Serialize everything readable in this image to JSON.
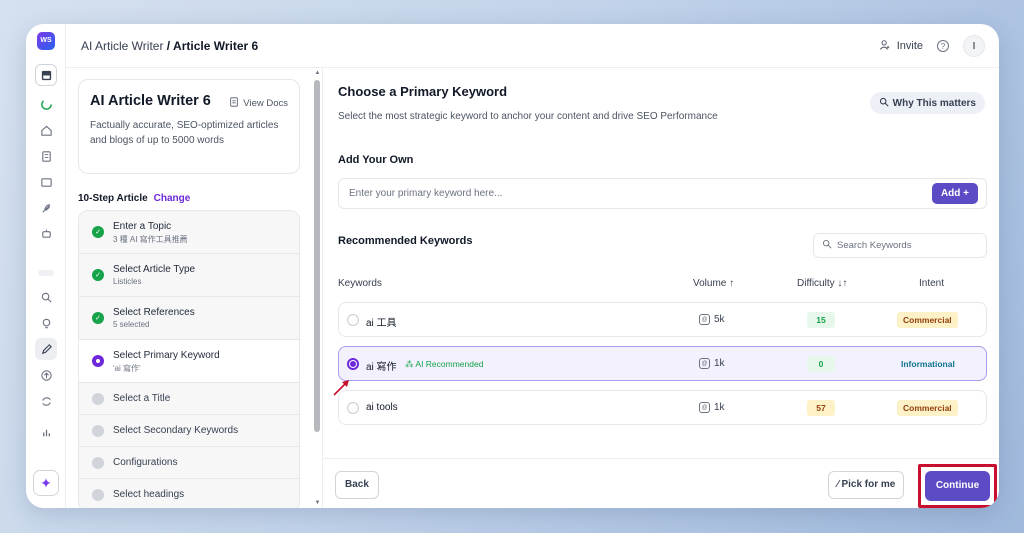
{
  "header": {
    "breadcrumb_parent": "AI Article Writer",
    "breadcrumb_sep": " / ",
    "breadcrumb_current": "Article Writer 6",
    "invite_label": "Invite",
    "help_symbol": "?",
    "avatar_initial": "I"
  },
  "rail": {
    "logo": "WS"
  },
  "info_card": {
    "title": "AI Article Writer 6",
    "view_docs": "View Docs",
    "description": "Factually accurate, SEO-optimized articles and blogs of up to 5000 words"
  },
  "steps_header": {
    "label": "10-Step Article",
    "change": "Change"
  },
  "steps": [
    {
      "title": "Enter a Topic",
      "sub": "3 種 AI 寫作工具推薦",
      "state": "done"
    },
    {
      "title": "Select Article Type",
      "sub": "Listicles",
      "state": "done"
    },
    {
      "title": "Select References",
      "sub": "5 selected",
      "state": "done"
    },
    {
      "title": "Select Primary Keyword",
      "sub": "'ai 寫作'",
      "state": "current"
    },
    {
      "title": "Select a Title",
      "state": "pending"
    },
    {
      "title": "Select Secondary Keywords",
      "state": "pending"
    },
    {
      "title": "Configurations",
      "state": "pending"
    },
    {
      "title": "Select headings",
      "state": "pending"
    }
  ],
  "main": {
    "title": "Choose a Primary Keyword",
    "subtitle": "Select the most strategic keyword to anchor your content and drive SEO Performance",
    "why_button": "Why This matters",
    "add_own_label": "Add Your Own",
    "keyword_input_placeholder": "Enter your primary keyword here...",
    "add_button": "Add +",
    "recommended_label": "Recommended Keywords",
    "search_placeholder": "Search Keywords",
    "columns": {
      "keywords": "Keywords",
      "volume": "Volume ↑",
      "difficulty": "Difficulty ↓↑",
      "intent": "Intent"
    },
    "rows": [
      {
        "keyword": "ai 工具",
        "badge": "",
        "volume": "5k",
        "difficulty": "15",
        "difficulty_color": "green",
        "intent": "Commercial",
        "selected": false
      },
      {
        "keyword": "ai 寫作",
        "badge": "AI Recommended",
        "volume": "1k",
        "difficulty": "0",
        "difficulty_color": "green",
        "intent": "Informational",
        "selected": true
      },
      {
        "keyword": "ai tools",
        "badge": "",
        "volume": "1k",
        "difficulty": "57",
        "difficulty_color": "yellow",
        "intent": "Commercial",
        "selected": false
      }
    ]
  },
  "footer": {
    "back": "Back",
    "pick_for_me": "Pick for me",
    "continue": "Continue"
  },
  "colors": {
    "accent": "#5b4bc4",
    "highlight_box": "#c8102e",
    "success": "#16a34a"
  }
}
